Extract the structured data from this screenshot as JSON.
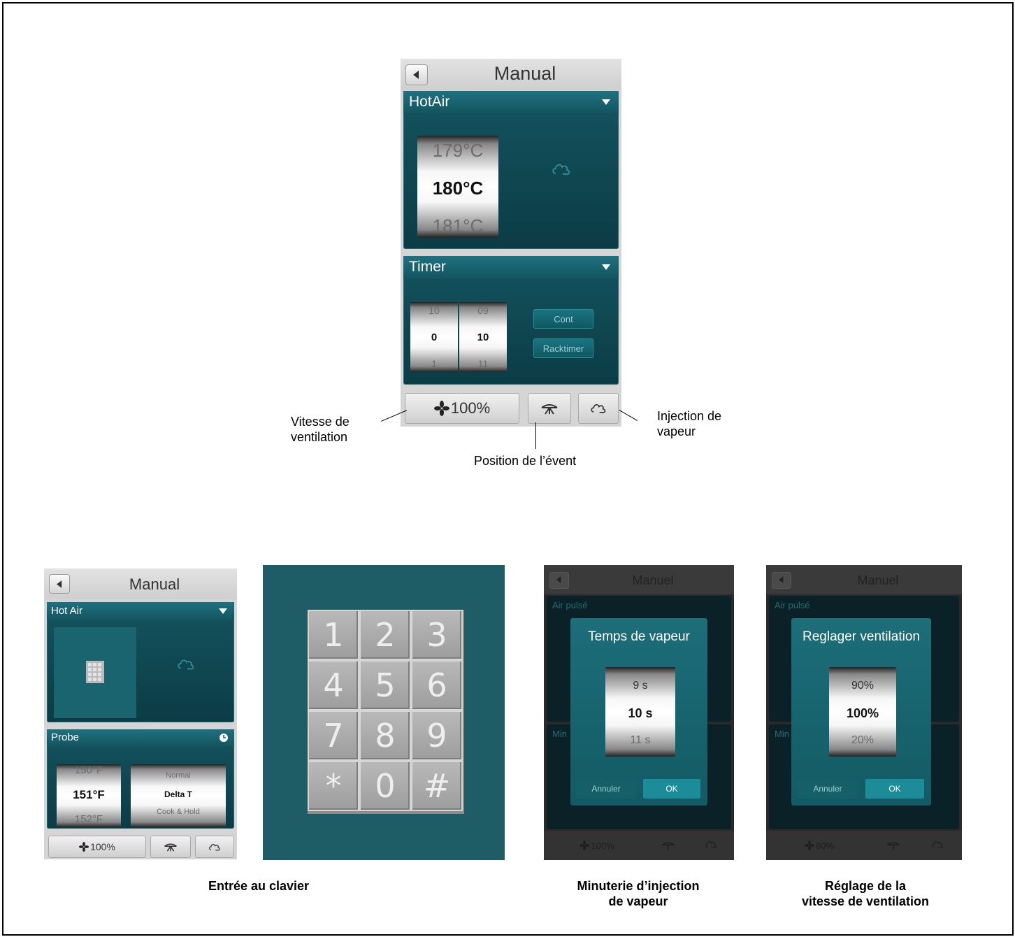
{
  "main_screen": {
    "title": "Manual",
    "mode_panel": {
      "title": "HotAir",
      "temp_prev": "179°C",
      "temp_selected": "180°C",
      "temp_next": "181°C"
    },
    "timer_panel": {
      "title": "Timer",
      "hours_prev": "10",
      "hours_selected": "0",
      "hours_next": "1",
      "minutes_prev": "09",
      "minutes_selected": "10",
      "minutes_next": "11",
      "cont_button": "Cont",
      "racktimer_button": "Racktimer"
    },
    "footer": {
      "fan_speed": "100%"
    }
  },
  "callouts": {
    "fan_speed": "Vitesse de\nventilation",
    "vent_position": "Position de l’évent",
    "steam_injection": "Injection de\nvapeur"
  },
  "probe_screen": {
    "title": "Manual",
    "mode_panel": {
      "title": "Hot Air"
    },
    "probe_panel": {
      "title": "Probe",
      "temp_prev": "150°F",
      "temp_selected": "151°F",
      "temp_next": "152°F",
      "mode_prev": "Normal",
      "mode_selected": "Delta T",
      "mode_next": "Cook & Hold"
    },
    "footer": {
      "fan_speed": "100%"
    }
  },
  "keypad": {
    "keys": [
      "1",
      "2",
      "3",
      "4",
      "5",
      "6",
      "7",
      "8",
      "9",
      "*",
      "0",
      "#"
    ]
  },
  "steam_timer_screen": {
    "title": "Manuel",
    "panel_label": "Air pulsé",
    "lower_label": "Min",
    "dialog_title": "Temps de vapeur",
    "prev": "9 s",
    "selected": "10 s",
    "next": "11 s",
    "cancel": "Annuler",
    "ok": "OK",
    "footer_fan": "100%"
  },
  "fan_screen": {
    "title": "Manuel",
    "panel_label": "Air pulsé",
    "lower_label": "Min",
    "dialog_title": "Reglager ventilation",
    "prev": "90%",
    "selected": "100%",
    "next": "20%",
    "cancel": "Annuler",
    "ok": "OK",
    "footer_fan": "80%"
  },
  "captions": {
    "keypad": "Entrée au clavier",
    "steam_timer": "Minuterie d’injection\nde vapeur",
    "fan": "Réglage de la\nvitesse de ventilation"
  },
  "icons": {
    "back": "back-arrow-icon",
    "fan": "fan-icon",
    "vent": "vent-icon",
    "steam": "steam-cloud-icon",
    "keypad": "keypad-icon",
    "clock": "clock-icon"
  }
}
